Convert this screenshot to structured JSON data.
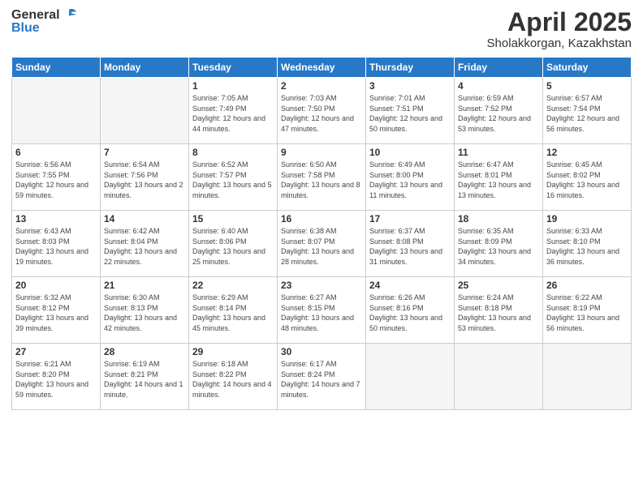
{
  "logo": {
    "general": "General",
    "blue": "Blue"
  },
  "header": {
    "month": "April 2025",
    "location": "Sholakkorgan, Kazakhstan"
  },
  "weekdays": [
    "Sunday",
    "Monday",
    "Tuesday",
    "Wednesday",
    "Thursday",
    "Friday",
    "Saturday"
  ],
  "weeks": [
    [
      {
        "day": "",
        "detail": ""
      },
      {
        "day": "",
        "detail": ""
      },
      {
        "day": "1",
        "detail": "Sunrise: 7:05 AM\nSunset: 7:49 PM\nDaylight: 12 hours\nand 44 minutes."
      },
      {
        "day": "2",
        "detail": "Sunrise: 7:03 AM\nSunset: 7:50 PM\nDaylight: 12 hours\nand 47 minutes."
      },
      {
        "day": "3",
        "detail": "Sunrise: 7:01 AM\nSunset: 7:51 PM\nDaylight: 12 hours\nand 50 minutes."
      },
      {
        "day": "4",
        "detail": "Sunrise: 6:59 AM\nSunset: 7:52 PM\nDaylight: 12 hours\nand 53 minutes."
      },
      {
        "day": "5",
        "detail": "Sunrise: 6:57 AM\nSunset: 7:54 PM\nDaylight: 12 hours\nand 56 minutes."
      }
    ],
    [
      {
        "day": "6",
        "detail": "Sunrise: 6:56 AM\nSunset: 7:55 PM\nDaylight: 12 hours\nand 59 minutes."
      },
      {
        "day": "7",
        "detail": "Sunrise: 6:54 AM\nSunset: 7:56 PM\nDaylight: 13 hours\nand 2 minutes."
      },
      {
        "day": "8",
        "detail": "Sunrise: 6:52 AM\nSunset: 7:57 PM\nDaylight: 13 hours\nand 5 minutes."
      },
      {
        "day": "9",
        "detail": "Sunrise: 6:50 AM\nSunset: 7:58 PM\nDaylight: 13 hours\nand 8 minutes."
      },
      {
        "day": "10",
        "detail": "Sunrise: 6:49 AM\nSunset: 8:00 PM\nDaylight: 13 hours\nand 11 minutes."
      },
      {
        "day": "11",
        "detail": "Sunrise: 6:47 AM\nSunset: 8:01 PM\nDaylight: 13 hours\nand 13 minutes."
      },
      {
        "day": "12",
        "detail": "Sunrise: 6:45 AM\nSunset: 8:02 PM\nDaylight: 13 hours\nand 16 minutes."
      }
    ],
    [
      {
        "day": "13",
        "detail": "Sunrise: 6:43 AM\nSunset: 8:03 PM\nDaylight: 13 hours\nand 19 minutes."
      },
      {
        "day": "14",
        "detail": "Sunrise: 6:42 AM\nSunset: 8:04 PM\nDaylight: 13 hours\nand 22 minutes."
      },
      {
        "day": "15",
        "detail": "Sunrise: 6:40 AM\nSunset: 8:06 PM\nDaylight: 13 hours\nand 25 minutes."
      },
      {
        "day": "16",
        "detail": "Sunrise: 6:38 AM\nSunset: 8:07 PM\nDaylight: 13 hours\nand 28 minutes."
      },
      {
        "day": "17",
        "detail": "Sunrise: 6:37 AM\nSunset: 8:08 PM\nDaylight: 13 hours\nand 31 minutes."
      },
      {
        "day": "18",
        "detail": "Sunrise: 6:35 AM\nSunset: 8:09 PM\nDaylight: 13 hours\nand 34 minutes."
      },
      {
        "day": "19",
        "detail": "Sunrise: 6:33 AM\nSunset: 8:10 PM\nDaylight: 13 hours\nand 36 minutes."
      }
    ],
    [
      {
        "day": "20",
        "detail": "Sunrise: 6:32 AM\nSunset: 8:12 PM\nDaylight: 13 hours\nand 39 minutes."
      },
      {
        "day": "21",
        "detail": "Sunrise: 6:30 AM\nSunset: 8:13 PM\nDaylight: 13 hours\nand 42 minutes."
      },
      {
        "day": "22",
        "detail": "Sunrise: 6:29 AM\nSunset: 8:14 PM\nDaylight: 13 hours\nand 45 minutes."
      },
      {
        "day": "23",
        "detail": "Sunrise: 6:27 AM\nSunset: 8:15 PM\nDaylight: 13 hours\nand 48 minutes."
      },
      {
        "day": "24",
        "detail": "Sunrise: 6:26 AM\nSunset: 8:16 PM\nDaylight: 13 hours\nand 50 minutes."
      },
      {
        "day": "25",
        "detail": "Sunrise: 6:24 AM\nSunset: 8:18 PM\nDaylight: 13 hours\nand 53 minutes."
      },
      {
        "day": "26",
        "detail": "Sunrise: 6:22 AM\nSunset: 8:19 PM\nDaylight: 13 hours\nand 56 minutes."
      }
    ],
    [
      {
        "day": "27",
        "detail": "Sunrise: 6:21 AM\nSunset: 8:20 PM\nDaylight: 13 hours\nand 59 minutes."
      },
      {
        "day": "28",
        "detail": "Sunrise: 6:19 AM\nSunset: 8:21 PM\nDaylight: 14 hours\nand 1 minute."
      },
      {
        "day": "29",
        "detail": "Sunrise: 6:18 AM\nSunset: 8:22 PM\nDaylight: 14 hours\nand 4 minutes."
      },
      {
        "day": "30",
        "detail": "Sunrise: 6:17 AM\nSunset: 8:24 PM\nDaylight: 14 hours\nand 7 minutes."
      },
      {
        "day": "",
        "detail": ""
      },
      {
        "day": "",
        "detail": ""
      },
      {
        "day": "",
        "detail": ""
      }
    ]
  ]
}
